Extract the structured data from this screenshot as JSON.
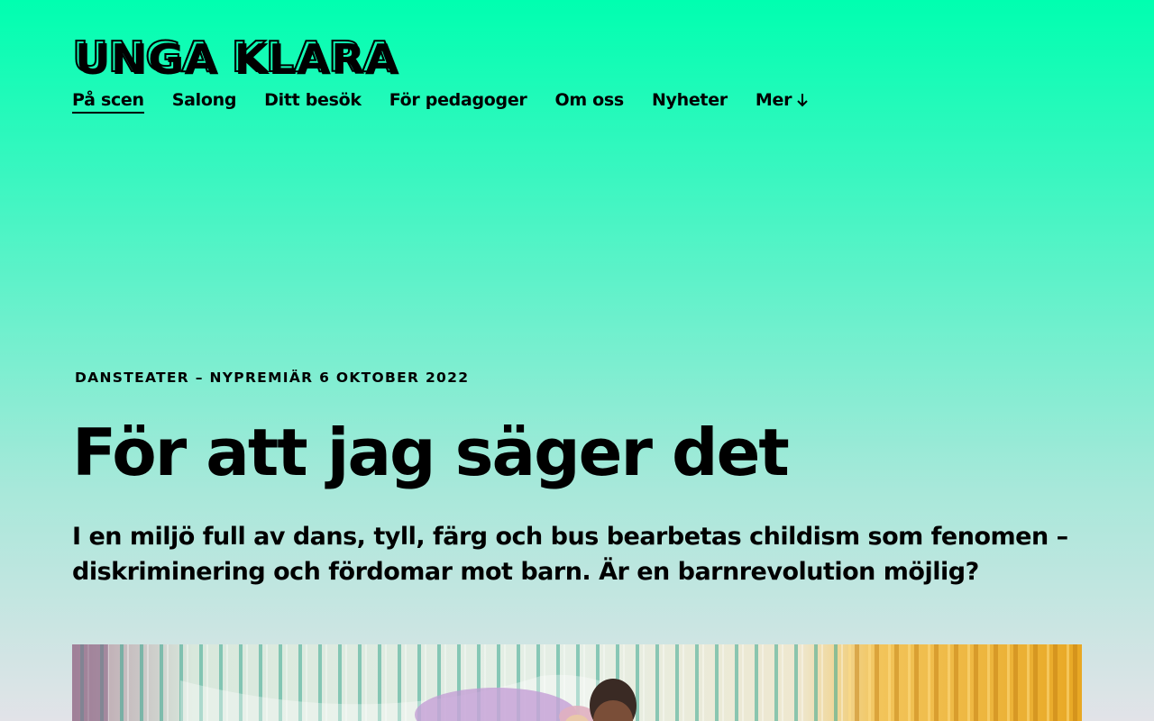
{
  "header": {
    "logo_text": "UNGA KLARA"
  },
  "nav": {
    "items": [
      {
        "label": "På scen",
        "active": true
      },
      {
        "label": "Salong",
        "active": false
      },
      {
        "label": "Ditt besök",
        "active": false
      },
      {
        "label": "För pedagoger",
        "active": false
      },
      {
        "label": "Om oss",
        "active": false
      },
      {
        "label": "Nyheter",
        "active": false
      },
      {
        "label": "Mer",
        "active": false,
        "icon": "arrow-down-icon"
      }
    ]
  },
  "production": {
    "eyebrow": "DANSTEATER – NYPREMIÄR 6 OKTOBER 2022",
    "title": "För att jag säger det",
    "lede": "I en miljö full av dans, tyll, färg och bus bearbetas childism som fenomen – diskriminering och fördomar mot barn. Är en barnrevolution möjlig?"
  },
  "colors": {
    "background_top": "#00ffb0",
    "background_bottom": "#e2e3e8",
    "text": "#000000",
    "curtain_yellow": "#f0b020"
  }
}
